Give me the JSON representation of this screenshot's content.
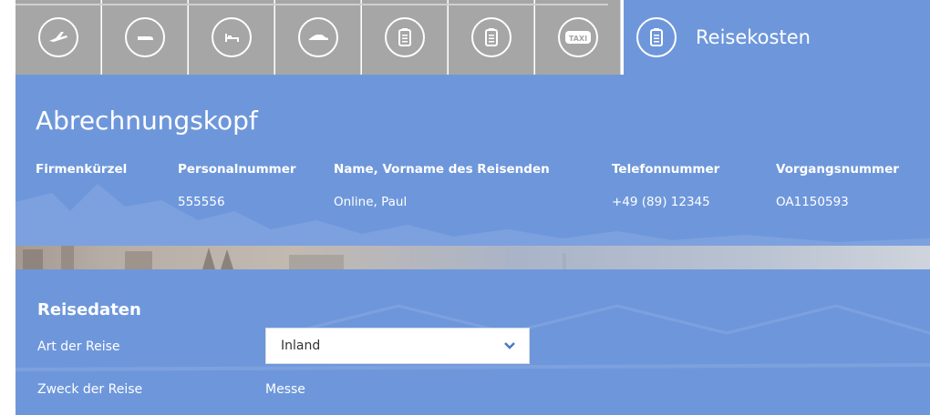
{
  "nav": {
    "tabs": [
      {
        "icon": "plane-icon"
      },
      {
        "icon": "train-icon"
      },
      {
        "icon": "hotel-bed-icon"
      },
      {
        "icon": "car-icon"
      },
      {
        "icon": "clipboard-icon"
      },
      {
        "icon": "clipboard-icon"
      },
      {
        "icon": "taxi-icon",
        "badge": "TAXI"
      }
    ],
    "active": {
      "icon": "clipboard-icon",
      "label": "Reisekosten"
    }
  },
  "header": {
    "title": "Abrechnungskopf",
    "columns": [
      {
        "label": "Firmenkürzel",
        "value": ""
      },
      {
        "label": "Personalnummer",
        "value": "555556"
      },
      {
        "label": "Name, Vorname des Reisenden",
        "value": "Online, Paul"
      },
      {
        "label": "Telefonnummer",
        "value": "+49 (89) 12345"
      },
      {
        "label": "Vorgangsnummer",
        "value": "OA1150593"
      }
    ]
  },
  "travel": {
    "title": "Reisedaten",
    "type_label": "Art der Reise",
    "type_value": "Inland",
    "purpose_label": "Zweck der Reise",
    "purpose_value": "Messe"
  },
  "colors": {
    "accent": "#6e97db",
    "tab_inactive": "#a6a6a6"
  }
}
